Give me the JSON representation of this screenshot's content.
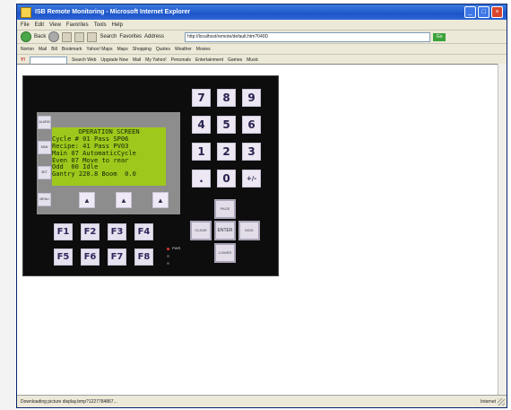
{
  "window": {
    "title": "ISB Remote Monitoring - Microsoft Internet Explorer",
    "buttons": [
      "_",
      "□",
      "×"
    ]
  },
  "menu": [
    "File",
    "Edit",
    "View",
    "Favorites",
    "Tools",
    "Help"
  ],
  "toolbar": {
    "back": "Back",
    "search": "Search",
    "favorites": "Favorites",
    "address_label": "Address",
    "address": "http://localhost/remote/default.htm?040D",
    "go": "Go"
  },
  "links_bar": [
    "Norton",
    "Mail",
    "Bill",
    "Bookmark",
    "Yahoo! Maps",
    "Maps",
    "Shopping",
    "Quotes",
    "Weather",
    "Movies"
  ],
  "yahoo_bar": {
    "label": "Y!",
    "items": [
      "Search Web",
      "Upgrade Now",
      "Mail",
      "My Yahoo!",
      "Personals",
      "Entertainment",
      "Games",
      "Music"
    ]
  },
  "status": {
    "text": "Downloading picture display.bmp?1227784867...",
    "zone": "Internet"
  },
  "lcd": {
    "lines": [
      "OPERATION SCREEN",
      "Cycle # 01 Pass SP06",
      "Recipe: 41 Pass PV03",
      "Main 07 AutomaticCycle",
      "Even 07 Move to rear",
      "Odd  00 Idle",
      "Gantry 220.8 Boom  0.0"
    ]
  },
  "side_keys": [
    "ALARM",
    "MAN",
    "SET"
  ],
  "bottom_keys": [
    "MENU",
    "▲",
    "▲",
    "▲"
  ],
  "fkeys": [
    "F1",
    "F2",
    "F3",
    "F4",
    "F5",
    "F6",
    "F7",
    "F8"
  ],
  "numpad": [
    "7",
    "8",
    "9",
    "4",
    "5",
    "6",
    "1",
    "2",
    "3",
    ".",
    "0",
    "+/-"
  ],
  "nav": {
    "up": "PAGE",
    "left": "CLEAR",
    "center": "ENTER",
    "right": "MOD",
    "down": "LOWER"
  },
  "leds": [
    {
      "label": "PWR",
      "color": "#e0332c"
    },
    {
      "label": "",
      "color": "#4a4a4a"
    },
    {
      "label": "",
      "color": "#4a4a4a"
    }
  ]
}
